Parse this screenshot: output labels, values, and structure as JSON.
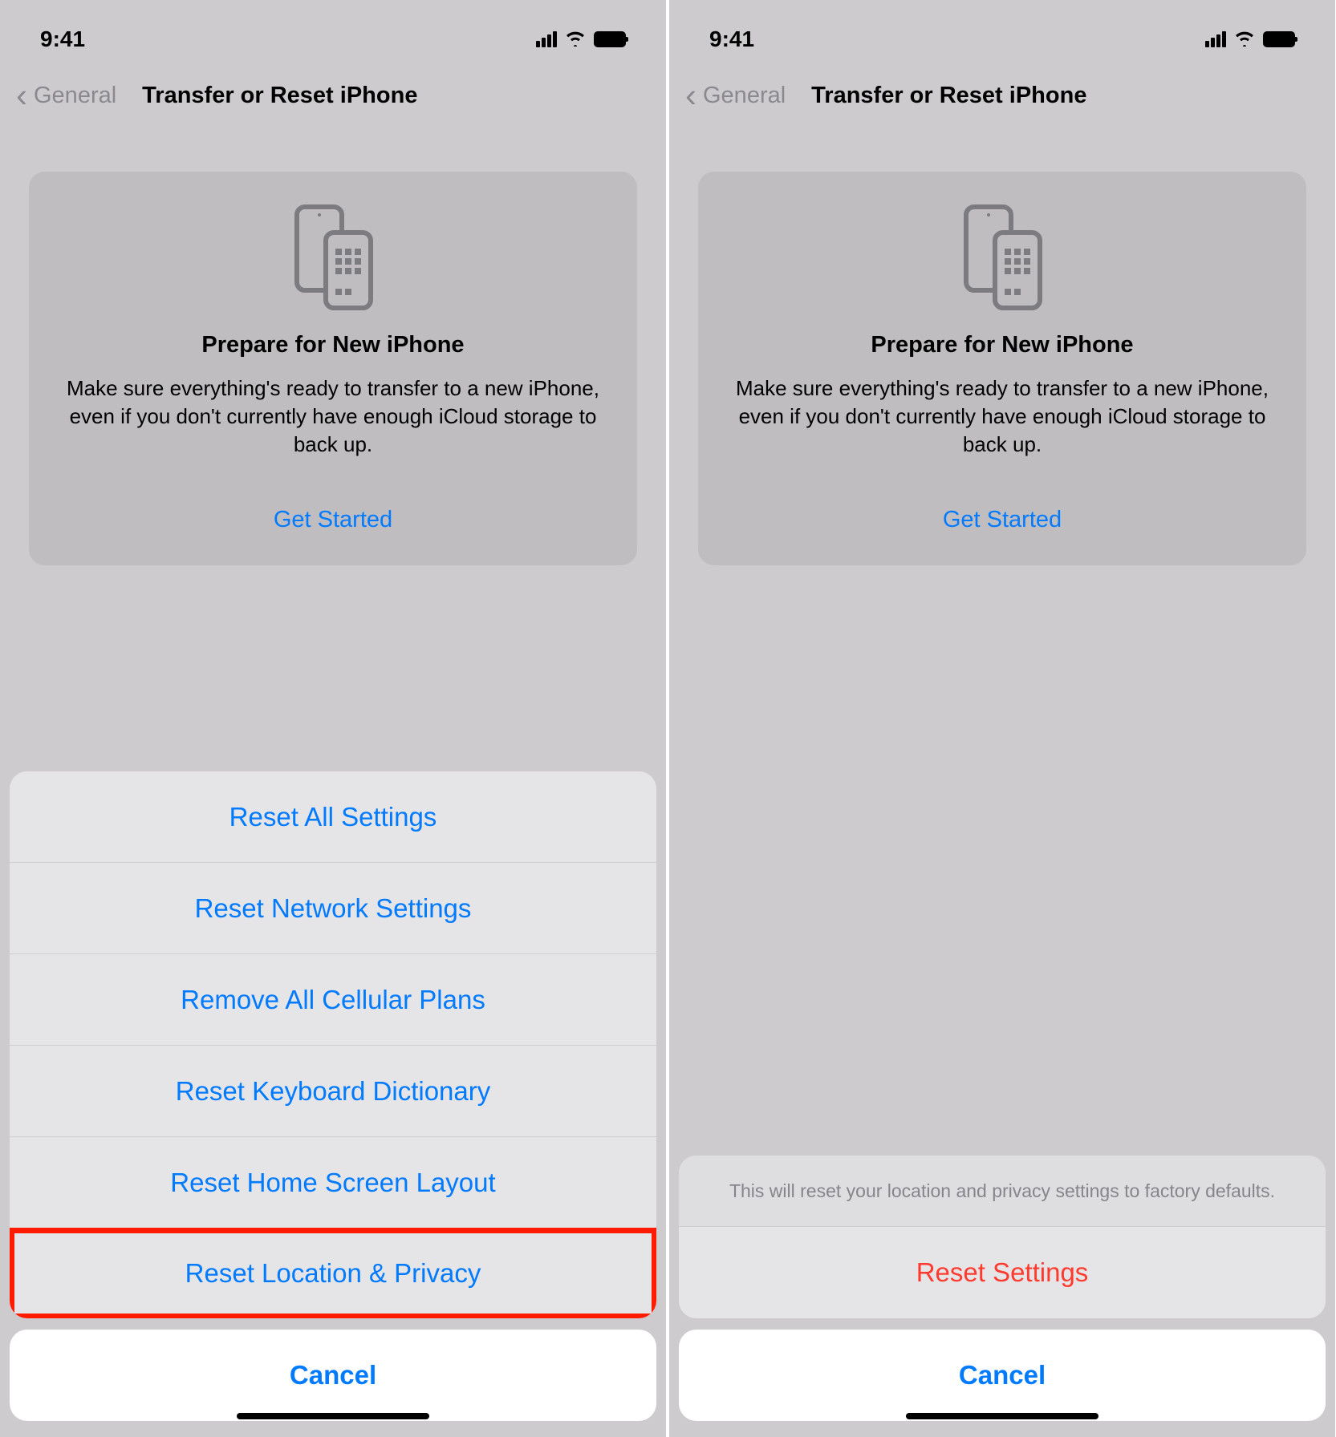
{
  "status": {
    "time": "9:41"
  },
  "nav": {
    "back_label": "General",
    "title": "Transfer or Reset iPhone"
  },
  "prepare_card": {
    "title": "Prepare for New iPhone",
    "subtitle": "Make sure everything's ready to transfer to a new iPhone, even if you don't currently have enough iCloud storage to back up.",
    "link": "Get Started"
  },
  "reset_sheet": {
    "options": [
      "Reset All Settings",
      "Reset Network Settings",
      "Remove All Cellular Plans",
      "Reset Keyboard Dictionary",
      "Reset Home Screen Layout",
      "Reset Location & Privacy"
    ],
    "cancel": "Cancel"
  },
  "confirm_sheet": {
    "message": "This will reset your location and privacy settings to factory defaults.",
    "action": "Reset Settings",
    "cancel": "Cancel"
  }
}
